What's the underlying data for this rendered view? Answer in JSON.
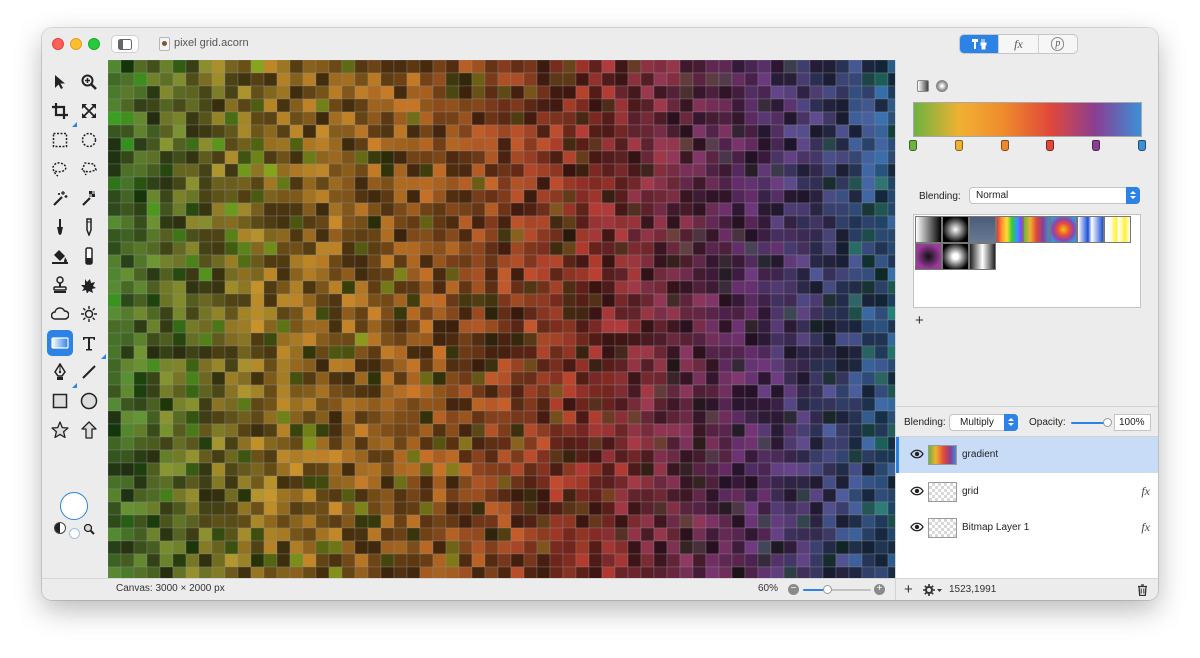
{
  "window": {
    "title": "pixel grid.acorn"
  },
  "palette_tabs": [
    {
      "label": "tools",
      "icon": "tools-icon",
      "active": true
    },
    {
      "label": "fx",
      "icon": "fx-icon",
      "active": false
    },
    {
      "label": "p",
      "icon": "p-icon",
      "active": false
    }
  ],
  "tools": [
    {
      "name": "move-tool",
      "icon": "arrow-icon"
    },
    {
      "name": "zoom-tool",
      "icon": "magnifier-icon"
    },
    {
      "name": "crop-tool",
      "icon": "crop-icon"
    },
    {
      "name": "transform-tool",
      "icon": "expand-icon"
    },
    {
      "name": "rect-select-tool",
      "icon": "dashed-rect-icon"
    },
    {
      "name": "oval-select-tool",
      "icon": "dashed-circle-icon"
    },
    {
      "name": "lasso-tool",
      "icon": "lasso-icon"
    },
    {
      "name": "poly-lasso-tool",
      "icon": "poly-lasso-icon"
    },
    {
      "name": "magic-wand-tool",
      "icon": "magic-wand-icon"
    },
    {
      "name": "instant-alpha-tool",
      "icon": "checker-wand-icon"
    },
    {
      "name": "brush-tool",
      "icon": "brush-icon"
    },
    {
      "name": "pencil-tool",
      "icon": "pencil-icon"
    },
    {
      "name": "paint-bucket-tool",
      "icon": "bucket-icon"
    },
    {
      "name": "eraser-tool",
      "icon": "eraser-icon"
    },
    {
      "name": "clone-tool",
      "icon": "stamp-icon"
    },
    {
      "name": "smudge-tool",
      "icon": "splat-icon"
    },
    {
      "name": "burn-tool",
      "icon": "cloud-icon"
    },
    {
      "name": "dodge-tool",
      "icon": "sun-icon"
    },
    {
      "name": "gradient-tool",
      "icon": "gradient-icon",
      "selected": true
    },
    {
      "name": "text-tool",
      "icon": "text-icon"
    },
    {
      "name": "bezier-tool",
      "icon": "pen-nib-icon"
    },
    {
      "name": "line-tool",
      "icon": "line-icon"
    },
    {
      "name": "rectangle-tool",
      "icon": "square-icon"
    },
    {
      "name": "oval-tool",
      "icon": "circle-icon"
    },
    {
      "name": "star-tool",
      "icon": "star-icon"
    },
    {
      "name": "arrow-shape-tool",
      "icon": "up-arrow-icon"
    }
  ],
  "gradient": {
    "stops": [
      {
        "color": "#6db33f",
        "position": 0.0
      },
      {
        "color": "#f0b132",
        "position": 0.2
      },
      {
        "color": "#ef8a2c",
        "position": 0.4
      },
      {
        "color": "#e0483a",
        "position": 0.6
      },
      {
        "color": "#8a3e92",
        "position": 0.8
      },
      {
        "color": "#3d8fd8",
        "position": 1.0
      }
    ],
    "blending_label": "Blending:",
    "blending_value": "Normal",
    "add_label": "+"
  },
  "layer_options": {
    "blending_label": "Blending:",
    "blending_value": "Multiply",
    "opacity_label": "Opacity:",
    "opacity_value": "100%",
    "opacity_level": 1.0
  },
  "layers": [
    {
      "name": "gradient",
      "selected": true,
      "visible": true,
      "has_fx": false
    },
    {
      "name": "grid",
      "selected": false,
      "visible": true,
      "has_fx": true
    },
    {
      "name": "Bitmap Layer 1",
      "selected": false,
      "visible": true,
      "has_fx": true
    }
  ],
  "fx_label": "fx",
  "status": {
    "canvas_size": "Canvas: 3000 × 2000 px",
    "zoom": "60%",
    "zoom_level": 0.6,
    "coords": "1523,1991",
    "add_layer_label": "+"
  },
  "colors": {
    "accent": "#2d82e6",
    "canvas_grid": "#8c8c8c"
  }
}
